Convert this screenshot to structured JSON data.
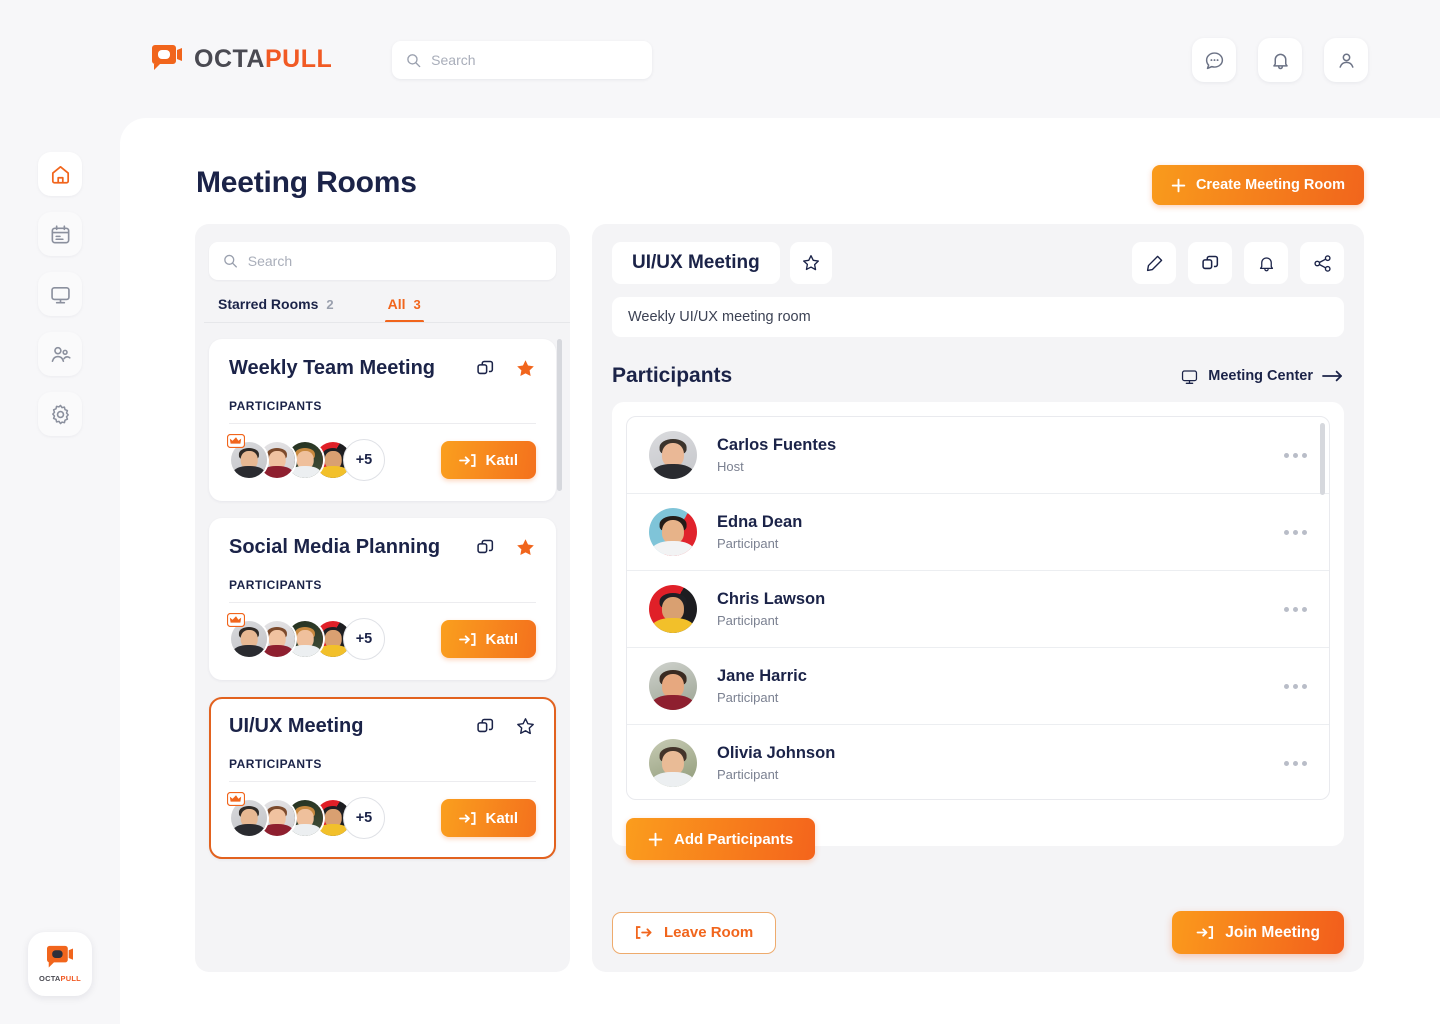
{
  "brand": {
    "name_dark": "OCTA",
    "name_orange": "PULL",
    "badge_dark": "OCTA",
    "badge_orange": "PULL"
  },
  "topbar": {
    "search_placeholder": "Search",
    "search_value": "",
    "icons": [
      "chat-icon",
      "bell-icon",
      "user-icon"
    ]
  },
  "sidebar": {
    "items": [
      {
        "name": "home",
        "icon": "home-icon",
        "active": true
      },
      {
        "name": "calendar",
        "icon": "calendar-icon",
        "active": false
      },
      {
        "name": "monitor",
        "icon": "monitor-icon",
        "active": false
      },
      {
        "name": "contacts",
        "icon": "users-icon",
        "active": false
      },
      {
        "name": "settings",
        "icon": "gear-icon",
        "active": false
      }
    ]
  },
  "header": {
    "title": "Meeting Rooms",
    "create_button": "Create Meeting Room"
  },
  "rooms_panel": {
    "search_placeholder": "Search",
    "search_value": "",
    "tabs": [
      {
        "label": "Starred Rooms",
        "count": "2",
        "active": false
      },
      {
        "label": "All",
        "count": "3",
        "active": true
      }
    ],
    "participants_label": "PARTICIPANTS",
    "cards": [
      {
        "title": "Weekly Team Meeting",
        "starred": true,
        "selected": false,
        "overflow": "+5",
        "join": "Katıl"
      },
      {
        "title": "Social Media Planning",
        "starred": true,
        "selected": false,
        "overflow": "+5",
        "join": "Katıl"
      },
      {
        "title": "UI/UX Meeting",
        "starred": false,
        "selected": true,
        "overflow": "+5",
        "join": "Katıl"
      }
    ]
  },
  "detail": {
    "room_title": "UI/UX Meeting",
    "description": "Weekly UI/UX meeting room",
    "starred": false,
    "header_icons": [
      "edit-pencil-icon",
      "copy-icon",
      "bell-icon",
      "share-icon"
    ],
    "participants_title": "Participants",
    "meeting_center": "Meeting Center",
    "participants": [
      {
        "name": "Carlos Fuentes",
        "role": "Host"
      },
      {
        "name": "Edna Dean",
        "role": "Participant"
      },
      {
        "name": "Chris Lawson",
        "role": "Participant"
      },
      {
        "name": "Jane Harric",
        "role": "Participant"
      },
      {
        "name": "Olivia Johnson",
        "role": "Participant"
      }
    ],
    "add_participants": "Add Participants",
    "leave_room": "Leave Room",
    "join_meeting": "Join Meeting"
  },
  "colors": {
    "accent_orange": "#f1651c",
    "accent_orange_light": "#fb9d1d",
    "title_navy": "#1b2348",
    "panel_grey": "#f4f4f6",
    "page_bg": "#f7f7f9"
  }
}
